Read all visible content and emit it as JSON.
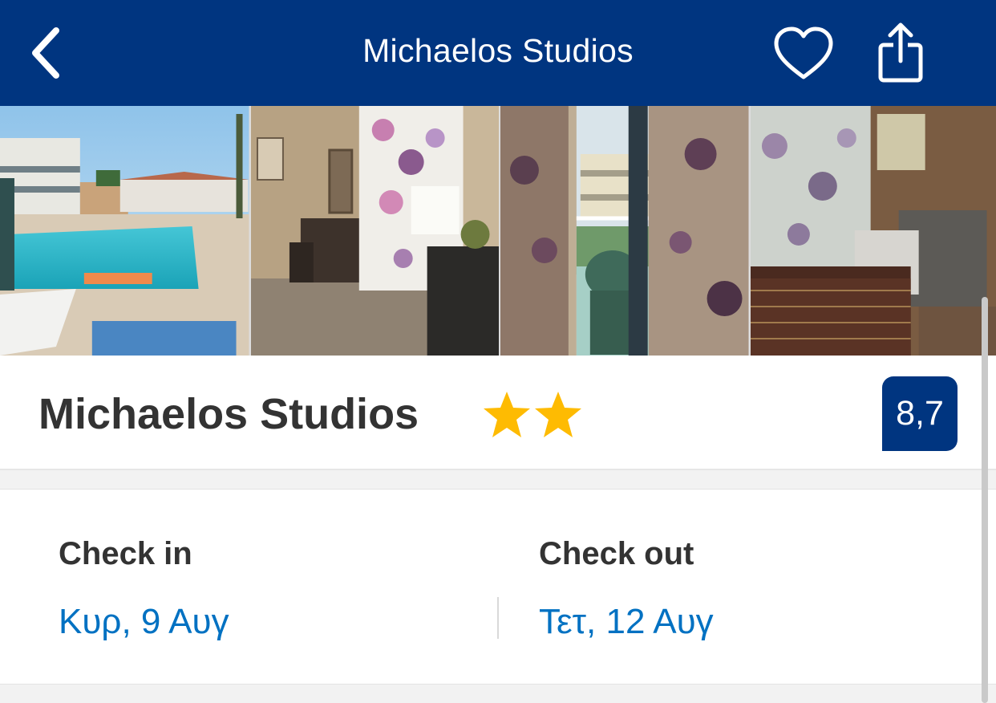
{
  "navbar": {
    "title": "Michaelos Studios",
    "back_icon": "chevron-left-icon",
    "favorite_icon": "heart-outline-icon",
    "share_icon": "share-icon"
  },
  "photos": [
    {
      "label": "pool",
      "scene": "pool"
    },
    {
      "label": "room-desk",
      "scene": "room"
    },
    {
      "label": "balcony",
      "scene": "balcony"
    },
    {
      "label": "kitchenette",
      "scene": "kitchen"
    }
  ],
  "hotel": {
    "name": "Michaelos Studios",
    "stars": 2,
    "star_color": "#febb02",
    "review_score": "8,7"
  },
  "dates": {
    "check_in_label": "Check in",
    "check_in_value": "Κυρ, 9 Αυγ",
    "check_out_label": "Check out",
    "check_out_value": "Τετ, 12 Αυγ"
  },
  "colors": {
    "brand": "#003580",
    "link": "#0071c2",
    "text": "#333333"
  }
}
